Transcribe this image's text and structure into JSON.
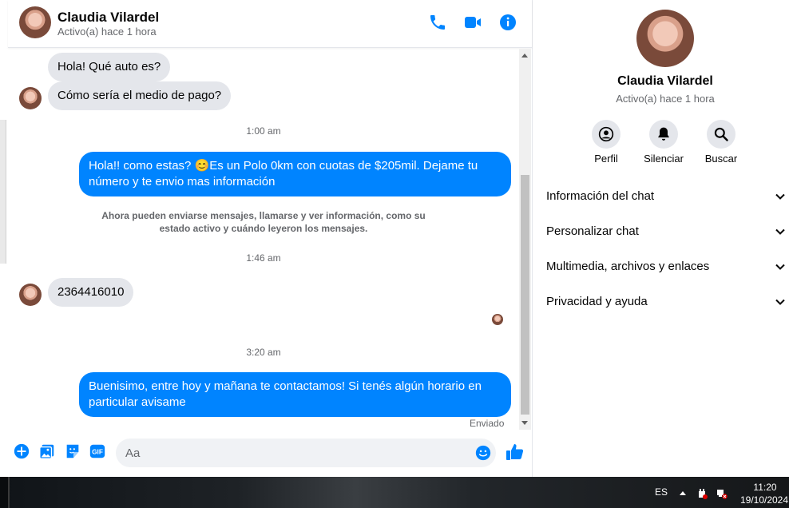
{
  "colors": {
    "accent": "#0084ff",
    "incoming_bubble": "#e4e6eb",
    "muted_text": "#65676b"
  },
  "header": {
    "name": "Claudia Vilardel",
    "status": "Activo(a) hace 1 hora",
    "icons": [
      "phone-icon",
      "video-icon",
      "info-icon"
    ]
  },
  "messages": {
    "in_1": "Hola! Qué auto es?",
    "in_2": "Cómo sería el medio de pago?",
    "time_1": "1:00 am",
    "out_1": "Hola!! como estas? 😊Es un Polo 0km con cuotas de $205mil. Dejame tu número y te envio mas información",
    "system_note": "Ahora pueden enviarse mensajes, llamarse y ver información, como su estado activo y cuándo leyeron los mensajes.",
    "time_2": "1:46 am",
    "in_3": "2364416010",
    "time_3": "3:20 am",
    "out_2": "Buenisimo, entre hoy y mañana te contactamos! Si tenés algún horario en particular avisame",
    "sent_label": "Enviado"
  },
  "composer": {
    "placeholder": "Aa",
    "icons": [
      "plus-icon",
      "image-icon",
      "sticker-icon",
      "gif-icon",
      "emoji-icon",
      "like-icon"
    ],
    "gif_label": "GIF"
  },
  "panel": {
    "name": "Claudia Vilardel",
    "status": "Activo(a) hace 1 hora",
    "actions": [
      {
        "label": "Perfil",
        "icon": "profile-icon"
      },
      {
        "label": "Silenciar",
        "icon": "bell-icon"
      },
      {
        "label": "Buscar",
        "icon": "search-icon"
      }
    ],
    "sections": [
      {
        "label": "Información del chat"
      },
      {
        "label": "Personalizar chat"
      },
      {
        "label": "Multimedia, archivos y enlaces"
      },
      {
        "label": "Privacidad y ayuda"
      }
    ]
  },
  "taskbar": {
    "language": "ES",
    "time": "11:20",
    "date": "19/10/2024"
  }
}
